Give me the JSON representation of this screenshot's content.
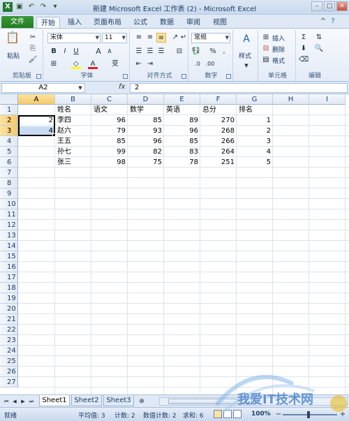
{
  "window": {
    "title": "新建 Microsoft Excel 工作表 (2) - Microsoft Excel"
  },
  "tabs": [
    "文件",
    "开始",
    "插入",
    "页面布局",
    "公式",
    "数据",
    "审阅",
    "视图"
  ],
  "ribbon": {
    "clipboard": {
      "paste_label": "粘贴",
      "group_label": "剪贴板"
    },
    "font": {
      "font_name": "宋体",
      "font_size": "11",
      "group_label": "字体",
      "bold": "B",
      "italic": "I",
      "underline": "U",
      "grow": "A",
      "shrink": "A",
      "font_color_glyph": "A",
      "phonetic": "变"
    },
    "alignment": {
      "group_label": "对齐方式"
    },
    "number": {
      "format": "常规",
      "group_label": "数字"
    },
    "styles": {
      "label": "样式"
    },
    "cells": {
      "insert": "插入",
      "delete": "删除",
      "format": "格式",
      "group_label": "单元格"
    },
    "editing": {
      "group_label": "编辑"
    }
  },
  "formula_bar": {
    "name_box": "A2",
    "fx": "fx",
    "value": "2"
  },
  "columns": [
    "A",
    "B",
    "C",
    "D",
    "E",
    "F",
    "G",
    "H",
    "I"
  ],
  "rows": [
    "1",
    "2",
    "3",
    "4",
    "5",
    "6",
    "7",
    "8",
    "9",
    "10",
    "11",
    "12",
    "13",
    "14",
    "15",
    "16",
    "17",
    "18",
    "19",
    "20",
    "21",
    "22",
    "23",
    "24",
    "25",
    "26",
    "27"
  ],
  "table": {
    "headers": [
      "姓名",
      "语文",
      "数学",
      "英语",
      "总分",
      "排名"
    ],
    "rows": [
      {
        "a": "2",
        "name": "李四",
        "chinese": "96",
        "math": "85",
        "english": "89",
        "total": "270",
        "rank": "1"
      },
      {
        "a": "4",
        "name": "赵六",
        "chinese": "79",
        "math": "93",
        "english": "96",
        "total": "268",
        "rank": "2"
      },
      {
        "a": "",
        "name": "王五",
        "chinese": "85",
        "math": "96",
        "english": "85",
        "total": "266",
        "rank": "3"
      },
      {
        "a": "",
        "name": "孙七",
        "chinese": "99",
        "math": "82",
        "english": "83",
        "total": "264",
        "rank": "4"
      },
      {
        "a": "",
        "name": "张三",
        "chinese": "98",
        "math": "75",
        "english": "78",
        "total": "251",
        "rank": "5"
      }
    ]
  },
  "sheets": [
    "Sheet1",
    "Sheet2",
    "Sheet3"
  ],
  "status": {
    "mode": "就绪",
    "average": "平均值: 3",
    "count": "计数: 2",
    "numeric_count": "数值计数: 2",
    "sum": "求和: 6",
    "zoom": "100%"
  },
  "watermark": {
    "text": "我爱IT技术网"
  }
}
